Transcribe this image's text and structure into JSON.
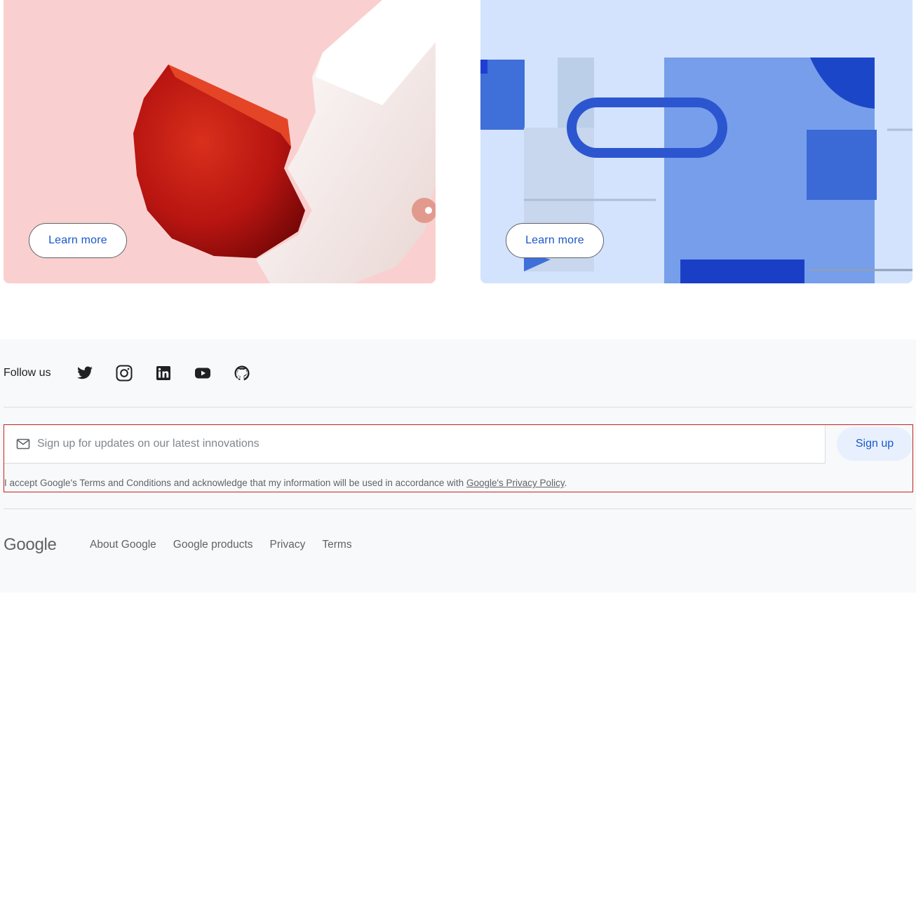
{
  "cards": [
    {
      "button_label": "Learn more",
      "background": "#f9d0cf"
    },
    {
      "button_label": "Learn more",
      "background": "#d3e3fd"
    }
  ],
  "footer": {
    "follow_label": "Follow us",
    "social_icons": [
      "twitter-icon",
      "instagram-icon",
      "linkedin-icon",
      "youtube-icon",
      "github-icon"
    ],
    "signup": {
      "placeholder": "Sign up for updates on our latest innovations",
      "value": "",
      "button_label": "Sign up",
      "consent_text": "I accept Google's Terms and Conditions and acknowledge that my information will be used in accordance with ",
      "privacy_link": "Google's Privacy Policy",
      "consent_end": "."
    },
    "logo_text": "Google",
    "links": [
      "About Google",
      "Google products",
      "Privacy",
      "Terms"
    ]
  },
  "colors": {
    "accent": "#1a56c9",
    "footer_bg": "#f8f9fa",
    "error_outline": "#c5221f"
  }
}
